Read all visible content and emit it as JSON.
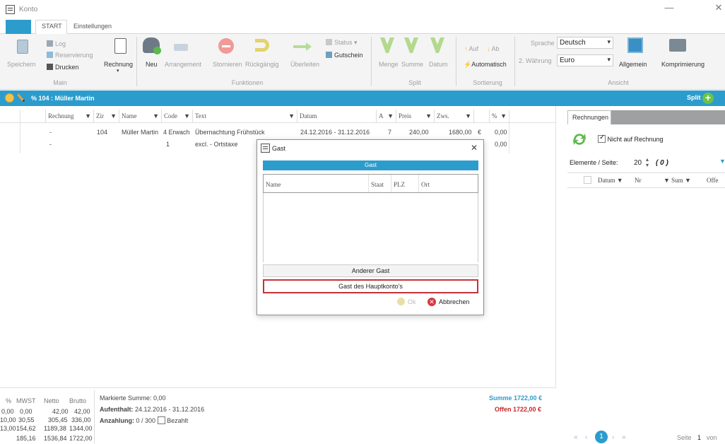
{
  "window": {
    "title": "Konto",
    "minimize": "—",
    "close": "✕"
  },
  "ribbon": {
    "tabs": [
      "START",
      "Einstellungen"
    ],
    "groups": {
      "main": "Main",
      "funktionen": "Funktionen",
      "split": "Split",
      "sortierung": "Sortierung",
      "ansicht": "Ansicht"
    },
    "main": {
      "save": "Speichern",
      "log": "Log",
      "reservierung": "Reservierung",
      "drucken": "Drucken",
      "rechnung": "Rechnung"
    },
    "funktionen": {
      "neu": "Neu",
      "arrangement": "Arrangement",
      "stornieren": "Stornieren",
      "rueckgaengig": "Rückgängig",
      "ueberleiten": "Überleiten",
      "status": "Status",
      "gutschein": "Gutschein"
    },
    "split": {
      "menge": "Menge",
      "summe": "Summe",
      "datum": "Datum"
    },
    "sortierung": {
      "auf": "Auf",
      "ab": "Ab",
      "automatisch": "Automatisch"
    },
    "ansicht": {
      "sprache_label": "Sprache",
      "sprache_value": "Deutsch",
      "waehrung_label": "2. Währung",
      "waehrung_value": "Euro",
      "allgemein": "Allgemein",
      "komprimierung": "Komprimierung"
    }
  },
  "account_bar": {
    "label": "% 104 : Müller Martin",
    "split": "Split"
  },
  "grid": {
    "columns": [
      "Rechnung",
      "Zir",
      "Name",
      "Code",
      "Text",
      "Datum",
      "A",
      "Preis",
      "Zws.",
      "",
      "%"
    ],
    "rows": [
      {
        "rechnung": "-",
        "zimmer": "104",
        "name": "Müller Martin",
        "code": "4 Erwach",
        "text": "Übernachtung Frühstück",
        "datum": "24.12.2016 - 31.12.2016",
        "anzahl": "7",
        "preis": "240,00",
        "zws": "1680,00",
        "waehrung": "€",
        "prozent": "0,00"
      },
      {
        "rechnung": "-",
        "zimmer": "",
        "name": "",
        "code": "1",
        "text": "excl. - Ortstaxe",
        "datum": "",
        "anzahl": "",
        "preis": "",
        "zws": "",
        "waehrung": "",
        "prozent": "0,00"
      }
    ]
  },
  "dialog": {
    "title": "Gast",
    "close": "✕",
    "header": "Gast",
    "columns": [
      "Name",
      "Staat",
      "PLZ",
      "Ort"
    ],
    "other_guest": "Anderer Gast",
    "main_account_guest": "Gast des Hauptkonto's",
    "ok": "Ok",
    "cancel": "Abbrechen"
  },
  "summary": {
    "table_headers": [
      "%",
      "MWST",
      "Netto",
      "Brutto"
    ],
    "table_rows": [
      [
        "0,00",
        "0,00",
        "42,00",
        "42,00"
      ],
      [
        "10,00",
        "30,55",
        "305,45",
        "336,00"
      ],
      [
        "13,00",
        "154,62",
        "1189,38",
        "1344,00"
      ],
      [
        "",
        "185,16",
        "1536,84",
        "1722,00"
      ]
    ],
    "marked_sum": "Markierte Summe: 0,00",
    "stay_label": "Aufenthalt:",
    "stay_value": "24.12.2016 - 31.12.2016",
    "deposit_label": "Anzahlung:",
    "deposit_value": "0 / 300",
    "paid_label": "Bezahlt",
    "sum_label": "Summe",
    "sum_value": "1722,00 €",
    "open_label": "Offen",
    "open_value": "1722,00 €"
  },
  "right_panel": {
    "tab": "Rechnungen",
    "not_on_invoice": "Nicht auf Rechnung",
    "per_page_label": "Elemente / Seite:",
    "per_page_value": "20",
    "count": "( 0 )",
    "columns": [
      "Datum",
      "Nr",
      "Sum",
      "Offe"
    ],
    "pager_page": "1",
    "pager_label": "Seite",
    "pager_of": "von"
  }
}
